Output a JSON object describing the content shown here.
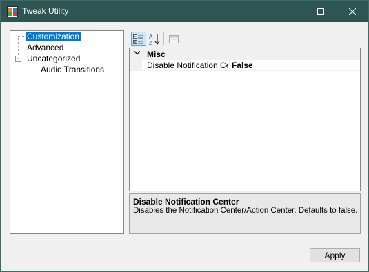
{
  "window": {
    "title": "Tweak Utility"
  },
  "caption_buttons": {
    "minimize": "minimize",
    "maximize": "maximize",
    "close": "close"
  },
  "tree": {
    "items": [
      {
        "label": "Customization",
        "selected": true
      },
      {
        "label": "Advanced"
      },
      {
        "label": "Uncategorized",
        "expander": "−"
      },
      {
        "label": "Audio Transitions"
      }
    ]
  },
  "propgrid": {
    "toolbar": {
      "categorized_icon": "categorized-icon",
      "alphabetical_icon": "alphabetical-icon",
      "property_pages_icon": "property-pages-icon"
    },
    "category": {
      "label": "Misc"
    },
    "properties": [
      {
        "name": "Disable Notification Center",
        "value": "False"
      }
    ],
    "help": {
      "title": "Disable Notification Center",
      "description": "Disables the Notification Center/Action Center. Defaults to false."
    }
  },
  "footer": {
    "apply_label": "Apply"
  },
  "colors": {
    "titlebar": "#2e5551",
    "selection": "#0078d7",
    "window_bg": "#f0f0f0"
  }
}
